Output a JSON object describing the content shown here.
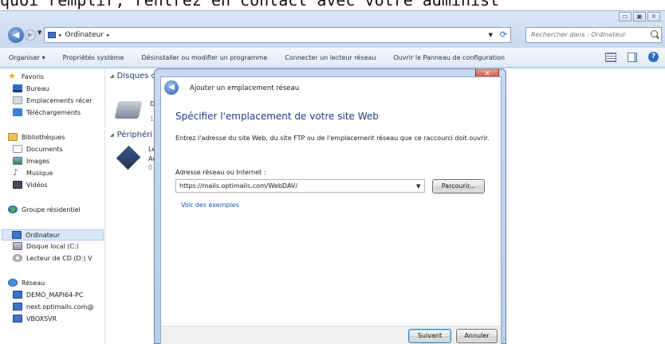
{
  "top_text": "quoi remplir, rentrez en contact avec votre administ",
  "window_buttons": {
    "minimize": "▭",
    "maximize": "▣",
    "close": "✕"
  },
  "address_bar": {
    "path": "Ordinateur",
    "separator": "▸",
    "search_placeholder": "Rechercher dans : Ordinateur"
  },
  "command_bar": {
    "items": [
      {
        "label": "Organiser ▾"
      },
      {
        "label": "Propriétés système"
      },
      {
        "label": "Désinstaller ou modifier un programme"
      },
      {
        "label": "Connecter un lecteur réseau"
      },
      {
        "label": "Ouvrir le Panneau de configuration"
      }
    ]
  },
  "nav_pane": {
    "favorites": "Favoris",
    "bureau": "Bureau",
    "emplacements": "Emplacements récer",
    "telechargements": "Téléchargements",
    "bibliotheques": "Bibliothèques",
    "documents": "Documents",
    "images": "Images",
    "musique": "Musique",
    "videos": "Vidéos",
    "groupe": "Groupe résidentiel",
    "ordinateur": "Ordinateur",
    "disque_local": "Disque local (C:)",
    "lecteur_cd": "Lecteur de CD (D:) V",
    "reseau": "Réseau",
    "demo": "DEMO_MAPI64-PC",
    "next": "next.optimails.com@",
    "vboxsvr": "VBOXSVR"
  },
  "content": {
    "group_disques": "Disques d",
    "disk_frag1": "Di",
    "disk_frag2": "14",
    "group_peripheriques": "Périphéri",
    "cd_frag1": "Le",
    "cd_frag2": "Ac",
    "cd_frag3": "0"
  },
  "dialog": {
    "close_label": "✕",
    "title": "Ajouter un emplacement réseau",
    "heading": "Spécifier l'emplacement de votre site Web",
    "description": "Entrez l'adresse du site Web, du site FTP ou de l'emplacement réseau que ce raccourci doit ouvrir.",
    "address_label": "Adresse réseau ou Internet :",
    "address_value": "https://mails.optimails.com/WebDAV/",
    "browse_button": "Parcourir...",
    "examples_link": "Voir des exemples",
    "next_button": "Suivant",
    "cancel_button": "Annuler"
  },
  "colors": {
    "accent_heading": "#1e3e8c",
    "link": "#1c55b8",
    "close_red": "#c8412a"
  }
}
